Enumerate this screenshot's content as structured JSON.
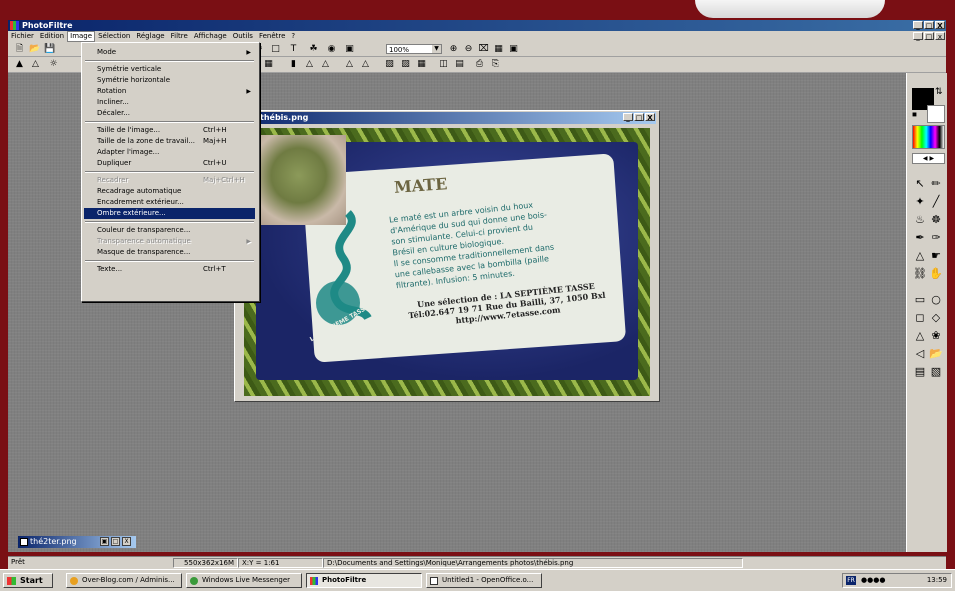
{
  "app": {
    "title": "PhotoFiltre",
    "window_buttons": [
      "_",
      "□",
      "X"
    ]
  },
  "menubar": {
    "items": [
      "Fichier",
      "Edition",
      "Image",
      "Sélection",
      "Réglage",
      "Filtre",
      "Affichage",
      "Outils",
      "Fenêtre",
      "?"
    ],
    "active": "Image"
  },
  "toolbar": {
    "zoom": "100%"
  },
  "image_menu": {
    "items": [
      {
        "label": "Mode",
        "shortcut": "",
        "submenu": true,
        "disabled": false
      },
      {
        "sep": true
      },
      {
        "label": "Symétrie verticale",
        "shortcut": "",
        "submenu": false,
        "disabled": false
      },
      {
        "label": "Symétrie horizontale",
        "shortcut": "",
        "submenu": false,
        "disabled": false
      },
      {
        "label": "Rotation",
        "shortcut": "",
        "submenu": true,
        "disabled": false
      },
      {
        "label": "Incliner...",
        "shortcut": "",
        "submenu": false,
        "disabled": false
      },
      {
        "label": "Décaler...",
        "shortcut": "",
        "submenu": false,
        "disabled": false
      },
      {
        "sep": true
      },
      {
        "label": "Taille de l'image...",
        "shortcut": "Ctrl+H",
        "submenu": false,
        "disabled": false
      },
      {
        "label": "Taille de la zone de travail...",
        "shortcut": "Maj+H",
        "submenu": false,
        "disabled": false
      },
      {
        "label": "Adapter l'image...",
        "shortcut": "",
        "submenu": false,
        "disabled": false
      },
      {
        "label": "Dupliquer",
        "shortcut": "Ctrl+U",
        "submenu": false,
        "disabled": false
      },
      {
        "sep": true
      },
      {
        "label": "Recadrer",
        "shortcut": "Maj+Ctrl+H",
        "submenu": false,
        "disabled": true
      },
      {
        "label": "Recadrage automatique",
        "shortcut": "",
        "submenu": false,
        "disabled": false
      },
      {
        "label": "Encadrement extérieur...",
        "shortcut": "",
        "submenu": false,
        "disabled": false
      },
      {
        "label": "Ombre extérieure...",
        "shortcut": "",
        "submenu": false,
        "disabled": false,
        "highlighted": true
      },
      {
        "sep": true
      },
      {
        "label": "Couleur de transparence...",
        "shortcut": "",
        "submenu": false,
        "disabled": false
      },
      {
        "label": "Transparence automatique",
        "shortcut": "",
        "submenu": true,
        "disabled": true
      },
      {
        "label": "Masque de transparence...",
        "shortcut": "",
        "submenu": false,
        "disabled": false
      },
      {
        "sep": true
      },
      {
        "label": "Texte...",
        "shortcut": "Ctrl+T",
        "submenu": false,
        "disabled": false
      }
    ]
  },
  "image_window": {
    "title": "thébis.png",
    "photo": {
      "heading": "MATE",
      "body": "Le maté est un arbre voisin du houx\nd'Amérique du sud qui donne une bois-\nson stimulante. Celui-ci provient du\nBrésil en culture biologique.\nIl se consomme traditionnellement dans\nune callebasse avec la bombilla (paille\nfiltrante). Infusion: 5 minutes.",
      "selection": "Une sélection de : LA SEPTIÈME TASSE\nTél:02.647 19 71 Rue du Bailli, 37, 1050 Bxl\nhttp://www.7etasse.com",
      "logo_text": "LA SEPTIÈME TASSE"
    }
  },
  "minimized_doc": {
    "title": "thé2ter.png"
  },
  "statusbar": {
    "state": "Prêt",
    "size": "550x362x16M",
    "coords": "X:Y = 1:61",
    "path": "D:\\Documents and Settings\\Monique\\Arrangements photos\\thébis.png"
  },
  "taskbar": {
    "start": "Start",
    "tasks": [
      "Over-Blog.com / Adminis...",
      "Windows Live Messenger",
      "PhotoFiltre",
      "Untitled1 - OpenOffice.o..."
    ],
    "active_task": "PhotoFiltre",
    "clock": "13:59",
    "lang": "FR"
  },
  "colors": {
    "titlebar": "#0a246a",
    "chrome": "#d4d0c8",
    "desktop_frame": "#7a0f14",
    "workspace": "#808080",
    "menu_highlight": "#0a246a"
  }
}
